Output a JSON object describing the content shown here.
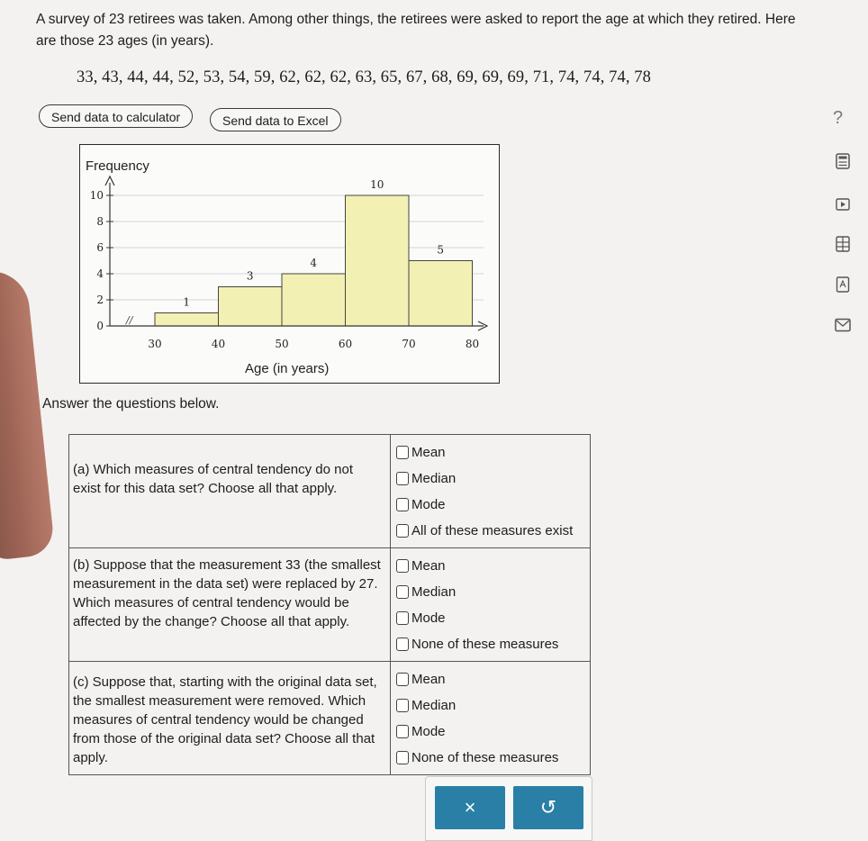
{
  "intro": {
    "line1": "A survey of 23 retirees was taken. Among other things, the retirees were asked to report the age at which they retired. Here",
    "line2": "are those 23 ages (in years).",
    "values": "33, 43, 44, 44, 52, 53, 54, 59, 62, 62, 62, 63, 65, 67, 68, 69, 69, 69, 71, 74, 74, 74, 78"
  },
  "toolbar": {
    "calculator_label": "Send data to calculator",
    "excel_label": "Send data to Excel",
    "help_label": "?"
  },
  "chart_data": {
    "type": "bar",
    "ylabel": "Frequency",
    "xlabel": "Age (in years)",
    "bins": [
      {
        "from": 30,
        "to": 40,
        "value": 1
      },
      {
        "from": 40,
        "to": 50,
        "value": 3
      },
      {
        "from": 50,
        "to": 60,
        "value": 4
      },
      {
        "from": 60,
        "to": 70,
        "value": 10
      },
      {
        "from": 70,
        "to": 80,
        "value": 5
      }
    ],
    "value_labels": [
      "1",
      "3",
      "4",
      "10",
      "5"
    ],
    "x_ticks": [
      "30",
      "40",
      "50",
      "60",
      "70",
      "80"
    ],
    "y_ticks": [
      "0",
      "2",
      "4",
      "6",
      "8",
      "10"
    ],
    "ylim": [
      0,
      10
    ],
    "xlim": [
      30,
      80
    ],
    "axis_break": "//",
    "grid": true,
    "bar_color": "#f3f0b3"
  },
  "answer_label": "Answer the questions below.",
  "questions": [
    {
      "text": "(a) Which measures of central tendency do not exist for this data set? Choose all that apply.",
      "options": [
        "Mean",
        "Median",
        "Mode",
        "All of these measures exist"
      ]
    },
    {
      "text": "(b) Suppose that the measurement 33 (the smallest measurement in the data set) were replaced by 27. Which measures of central tendency would be affected by the change? Choose all that apply.",
      "options": [
        "Mean",
        "Median",
        "Mode",
        "None of these measures"
      ]
    },
    {
      "text": "(c) Suppose that, starting with the original data set, the smallest measurement were removed. Which measures of central tendency would be changed from those of the original data set? Choose all that apply.",
      "options": [
        "Mean",
        "Median",
        "Mode",
        "None of these measures"
      ]
    }
  ],
  "actions": {
    "clear_label": "×",
    "undo_label": "↺"
  },
  "colors": {
    "accent": "#2a7fa6",
    "bar": "#f3f0b3"
  }
}
